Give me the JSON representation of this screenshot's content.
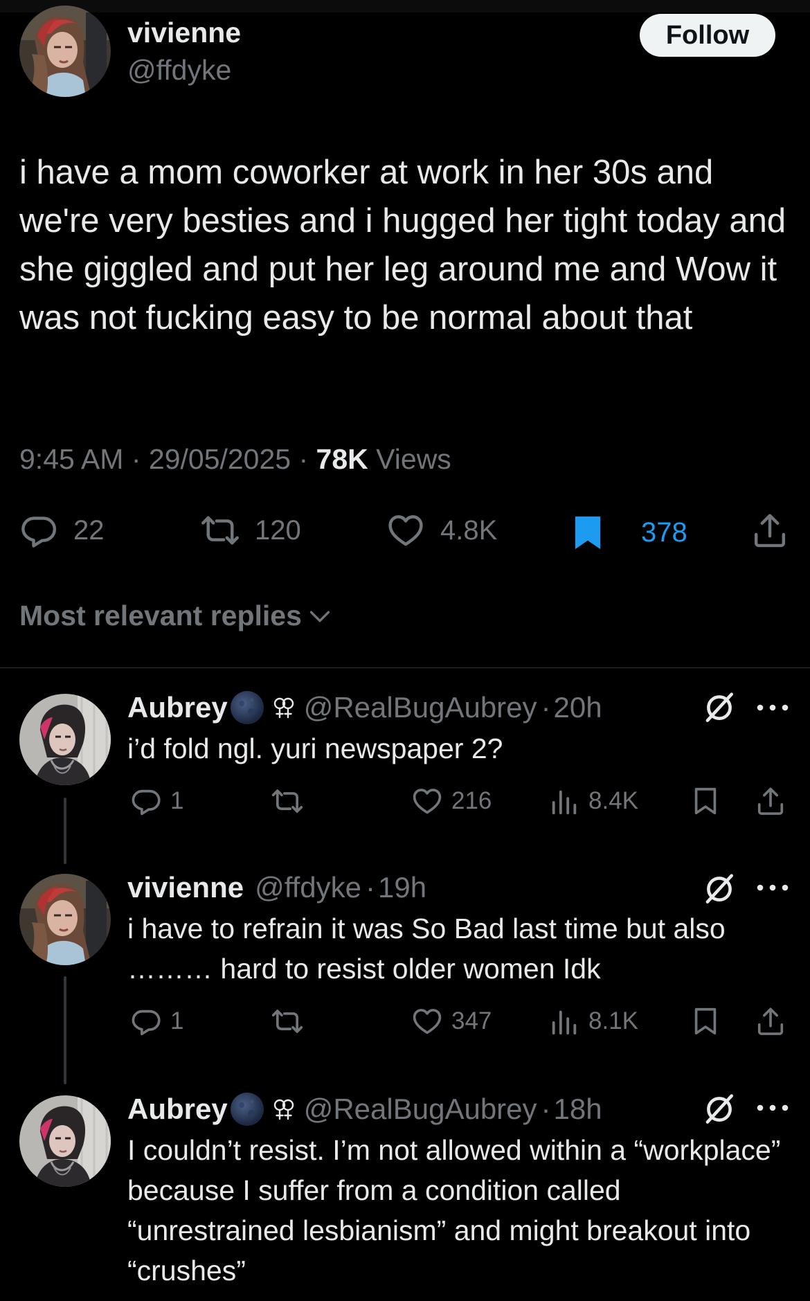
{
  "main_tweet": {
    "author_name": "vivienne",
    "author_handle": "@ffdyke",
    "follow_label": "Follow",
    "text": "i have a mom coworker at work in her 30s and we're very besties and i hugged her tight today and she giggled and put her leg around me and Wow it was not fucking easy to be normal about that",
    "time": "9:45 AM",
    "date": "29/05/2025",
    "views_count": "78K",
    "views_label": "Views",
    "stats": {
      "replies": "22",
      "reposts": "120",
      "likes": "4.8K",
      "bookmarks": "378"
    },
    "bookmark_color": "#1d9bf0"
  },
  "sort_label": "Most relevant replies",
  "replies": [
    {
      "name": "Aubrey",
      "handle": "@RealBugAubrey",
      "time": "20h",
      "text": "i’d fold ngl. yuri newspaper 2?",
      "replies": "1",
      "likes": "216",
      "views": "8.4K"
    },
    {
      "name": "vivienne",
      "handle": "@ffdyke",
      "time": "19h",
      "text": "i have to refrain it was So Bad last time but also ……… hard to resist older women Idk",
      "replies": "1",
      "likes": "347",
      "views": "8.1K"
    },
    {
      "name": "Aubrey",
      "handle": "@RealBugAubrey",
      "time": "18h",
      "text": "I couldn’t resist. I’m not allowed within a “workplace” because I suffer from a condition called “unrestrained lesbianism” and might breakout into “crushes”"
    }
  ],
  "icons": {
    "reply": "speech-bubble-icon",
    "repost": "repost-arrows-icon",
    "like": "heart-icon",
    "bookmark": "bookmark-icon",
    "share": "share-upload-icon",
    "views": "bar-chart-icon",
    "mute": "mute-circle-slash-icon",
    "more": "ellipsis-icon",
    "chevron": "chevron-down-icon",
    "emoji_moon": "new-moon-emoji-icon",
    "emoji_venus": "double-venus-icon"
  },
  "colors": {
    "background": "#000000",
    "text_primary": "#e7e9ea",
    "text_secondary": "#71767b",
    "accent": "#1d9bf0",
    "follow_bg": "#eff3f4"
  }
}
